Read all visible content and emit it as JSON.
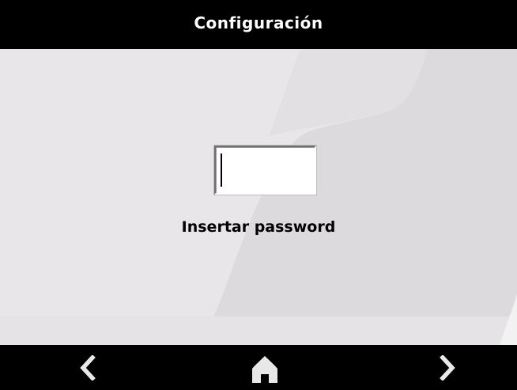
{
  "header": {
    "title": "Configuración"
  },
  "password_field": {
    "value": ""
  },
  "password_label": "Insertar password",
  "footer": {
    "back_icon": "chevron-left-icon",
    "home_icon": "home-icon",
    "forward_icon": "chevron-right-icon"
  },
  "colors": {
    "bar_background": "#000000",
    "content_background": "#dcdadd",
    "icon_color": "#e8e8e8",
    "text_color": "#000000",
    "title_color": "#ffffff"
  }
}
